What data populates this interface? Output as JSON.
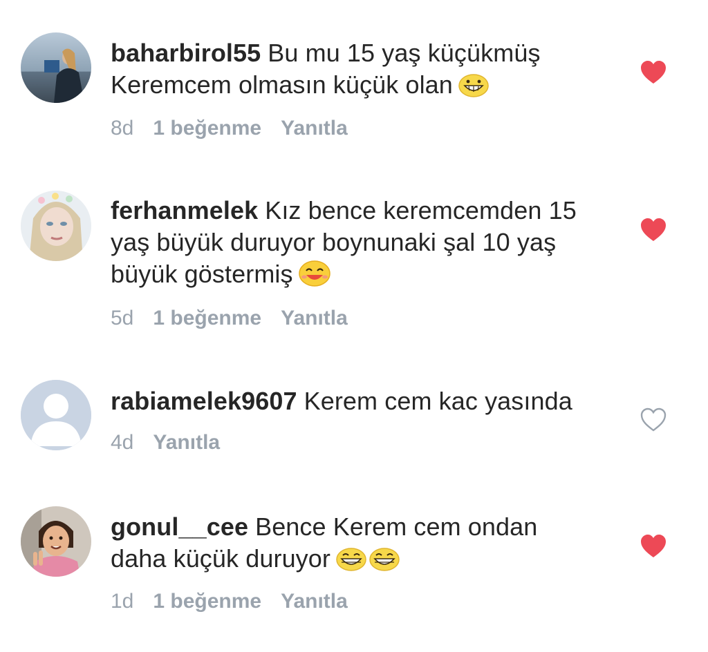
{
  "comments": [
    {
      "username": "baharbirol55",
      "line1": "Bu mu 15 yaş küçükmüş",
      "line2": "Keremcem olmasın küçük olan",
      "line3": "",
      "time": "8d",
      "likes": "1 beğenme",
      "reply": "Yanıtla",
      "liked": true,
      "emoji": "grinning-face-icon"
    },
    {
      "username": "ferhanmelek",
      "line1": "Kız bence keremcemden 15",
      "line2": "yaş büyük duruyor boynunaki şal 10 yaş",
      "line3": "büyük göstermiş",
      "time": "5d",
      "likes": "1 beğenme",
      "reply": "Yanıtla",
      "liked": true,
      "emoji": "smiling-face-icon"
    },
    {
      "username": "rabiamelek9607",
      "line1": "Kerem cem kac yasında",
      "line2": "",
      "line3": "",
      "time": "4d",
      "likes": "",
      "reply": "Yanıtla",
      "liked": false,
      "emoji": ""
    },
    {
      "username": "gonul__cee",
      "line1": "Bence Kerem cem ondan",
      "line2": "daha küçük duruyor",
      "line3": "",
      "time": "1d",
      "likes": "1 beğenme",
      "reply": "Yanıtla",
      "liked": true,
      "emoji": "beaming-face-icon"
    }
  ],
  "colors": {
    "heart_filled": "#ed4956",
    "heart_outline": "#9aa3ad",
    "meta_text": "#9aa3ad",
    "body_text": "#262626"
  }
}
